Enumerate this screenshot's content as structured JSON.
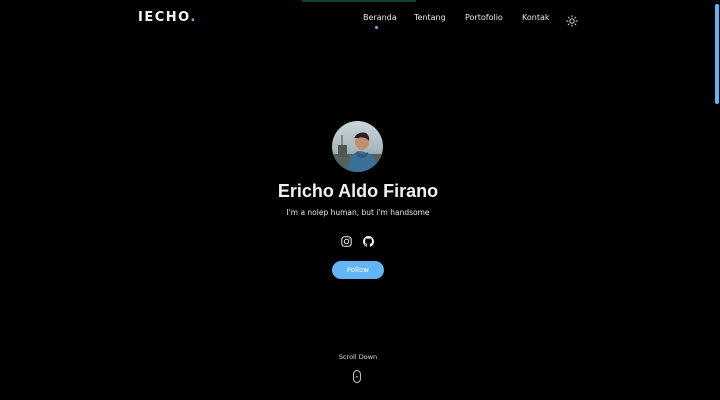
{
  "brand": {
    "logo_text": "IECHO",
    "logo_dot": ".",
    "accent_color": "#64b5f6",
    "background_color": "#000000"
  },
  "nav": {
    "items": [
      {
        "label": "Beranda",
        "active": true
      },
      {
        "label": "Tentang",
        "active": false
      },
      {
        "label": "Portofolio",
        "active": false
      },
      {
        "label": "Kontak",
        "active": false
      }
    ],
    "theme_toggle_icon": "sun-icon"
  },
  "hero": {
    "avatar_icon": "profile-photo",
    "name": "Ericho Aldo Firano",
    "tagline": "I'm a nolep human, but i'm handsome",
    "social": [
      {
        "icon": "instagram-icon"
      },
      {
        "icon": "github-icon"
      }
    ],
    "follow_label": "Follow"
  },
  "scroll": {
    "label": "Scroll Down",
    "icon": "mouse-icon"
  }
}
